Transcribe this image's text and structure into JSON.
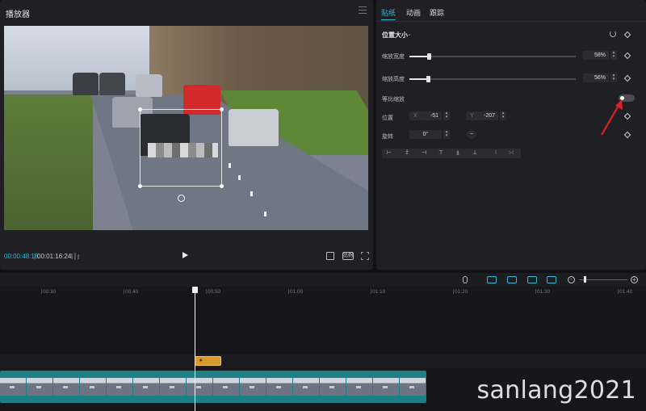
{
  "player": {
    "title": "播放器",
    "current_time": "00:00:48:18",
    "time_separator": "|",
    "total_time": "00:01:16:24",
    "ratio_label": "比例"
  },
  "inspector": {
    "tabs": [
      {
        "label": "贴纸",
        "active": true
      },
      {
        "label": "动画",
        "active": false
      },
      {
        "label": "跟踪",
        "active": false
      }
    ],
    "section_title": "位置大小",
    "scale_width": {
      "label": "缩放宽度",
      "value": "58%",
      "percent": 58
    },
    "scale_height": {
      "label": "缩放高度",
      "value": "56%",
      "percent": 56
    },
    "uniform_scale": {
      "label": "等比缩放",
      "enabled": false
    },
    "position": {
      "label": "位置",
      "x_label": "X",
      "x_value": "-51",
      "y_label": "Y",
      "y_value": "-207"
    },
    "rotation": {
      "label": "旋转",
      "value": "0°",
      "reset_symbol": "−"
    },
    "align_buttons": [
      "align-left",
      "align-center-h",
      "align-right",
      "align-top",
      "align-center-v",
      "align-bottom",
      "distribute-h",
      "distribute-v"
    ]
  },
  "timeline": {
    "ruler_labels": [
      "00:30",
      "00:40",
      "00:50",
      "01:00",
      "01:10",
      "01:20",
      "01:30",
      "01:40"
    ],
    "sticker_clip_label": "★",
    "video_clip_thumbnails": 16
  },
  "watermark": "sanlang2021",
  "colors": {
    "accent": "#2fb8d5",
    "sticker_clip": "#d79a2b",
    "video_clip": "#1e7f86",
    "annotation_arrow": "#e02020"
  }
}
